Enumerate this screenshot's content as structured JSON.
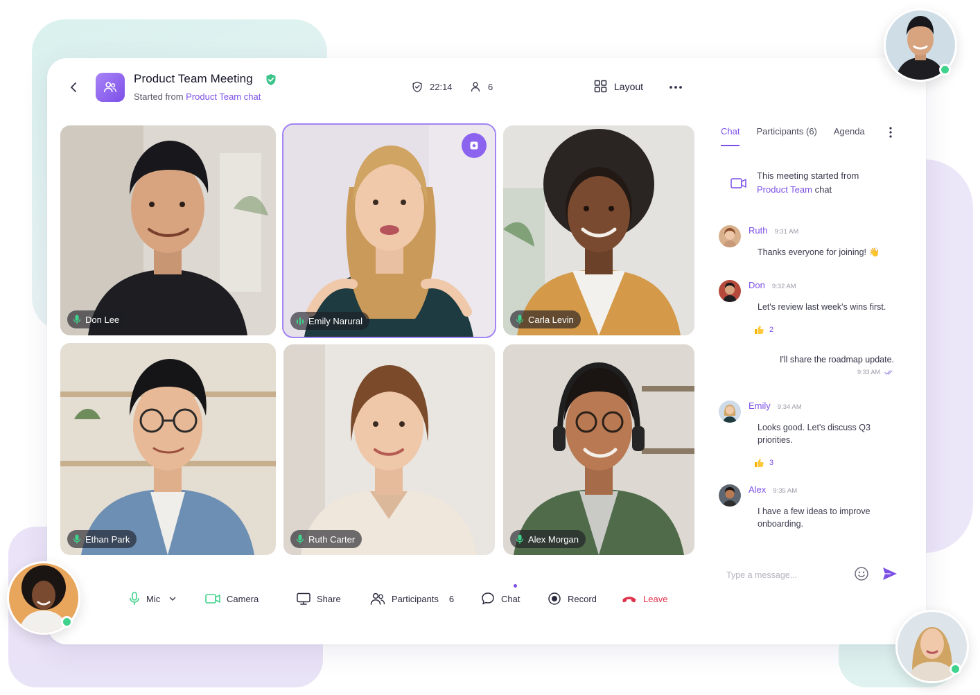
{
  "header": {
    "title": "Product Team Meeting",
    "subtitle_prefix": "Started from",
    "subtitle_link": "Product Team chat",
    "timer": "22:14",
    "participant_count": "6",
    "layout_label": "Layout"
  },
  "tiles": [
    {
      "name": "Don Lee",
      "mic": "on"
    },
    {
      "name": "Emily Narural",
      "mic": "speaking",
      "active": true
    },
    {
      "name": "Carla Levin",
      "mic": "on"
    },
    {
      "name": "Ethan Park",
      "mic": "on"
    },
    {
      "name": "Ruth Carter",
      "mic": "on"
    },
    {
      "name": "Alex Morgan",
      "mic": "on"
    }
  ],
  "panel": {
    "tabs": [
      "Chat",
      "Participants (6)",
      "Agenda"
    ],
    "active_tab": "Chat",
    "system_message_line1": "This meeting started from",
    "system_message_link": "Product Team",
    "system_message_suffix": "chat",
    "messages": [
      {
        "author": "Ruth",
        "time": "9:31 AM",
        "text": "Thanks everyone for joining! 👋"
      },
      {
        "author": "Don",
        "time": "9:32 AM",
        "text": "Let's review last week's wins first.",
        "reaction_count": "2"
      },
      {
        "author": "Emily",
        "time": "9:34 AM",
        "text": "Looks good. Let's discuss Q3 priorities.",
        "reaction_count": "3"
      },
      {
        "author": "Alex",
        "time": "9:35 AM",
        "text": "I have a few ideas to improve onboarding."
      }
    ],
    "own_message": {
      "text": "I'll share the roadmap update.",
      "time": "9:33 AM"
    },
    "composer_placeholder": "Type a message..."
  },
  "controls": {
    "mic": "Mic",
    "camera": "Camera",
    "share": "Share",
    "participants": "Participants",
    "participants_count": "6",
    "chat": "Chat",
    "record": "Record",
    "leave": "Leave"
  },
  "colors": {
    "accent": "#7b4fe6",
    "online": "#3fd28c",
    "leave": "#e0314b",
    "mic_on": "#3fd28c"
  }
}
